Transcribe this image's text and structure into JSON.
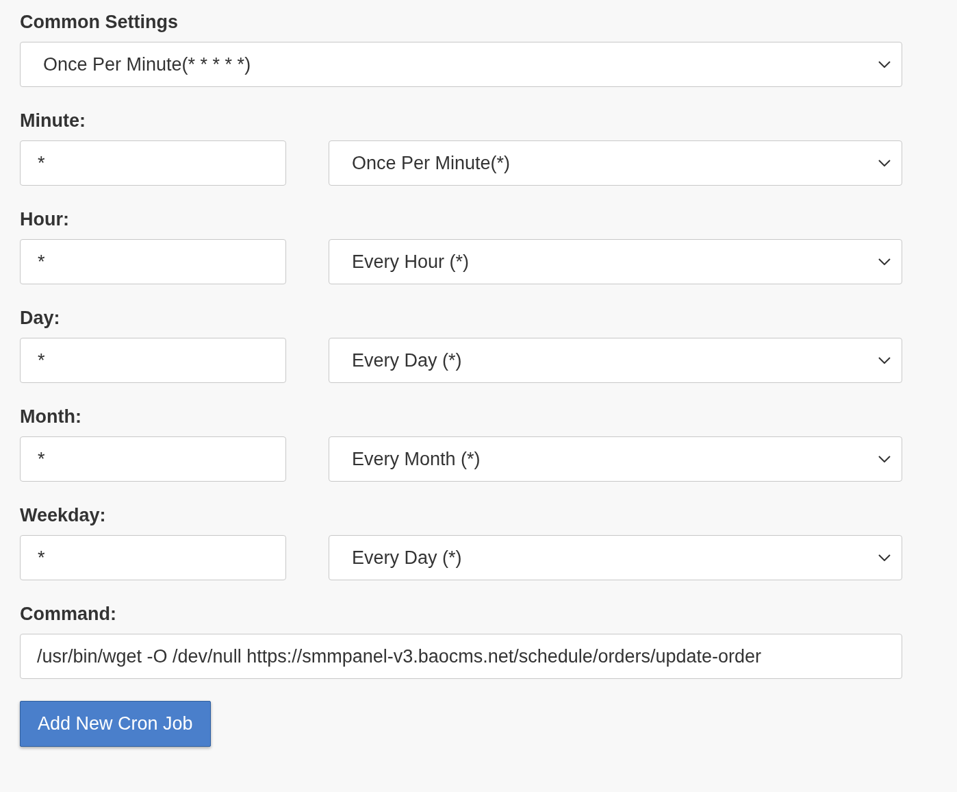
{
  "common_settings": {
    "label": "Common Settings",
    "value": "Once Per Minute(* * * * *)"
  },
  "fields": [
    {
      "label": "Minute:",
      "value": "*",
      "select": "Once Per Minute(*)"
    },
    {
      "label": "Hour:",
      "value": "*",
      "select": "Every Hour (*)"
    },
    {
      "label": "Day:",
      "value": "*",
      "select": "Every Day (*)"
    },
    {
      "label": "Month:",
      "value": "*",
      "select": "Every Month (*)"
    },
    {
      "label": "Weekday:",
      "value": "*",
      "select": "Every Day (*)"
    }
  ],
  "command": {
    "label": "Command:",
    "value": "/usr/bin/wget -O /dev/null https://smmpanel-v3.baocms.net/schedule/orders/update-order"
  },
  "button": "Add New Cron Job"
}
